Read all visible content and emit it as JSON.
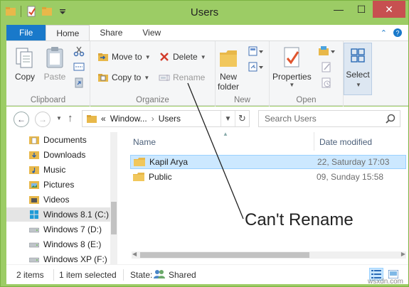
{
  "window": {
    "title": "Users",
    "controls": {
      "minimize": "—",
      "maximize": "☐",
      "close": "✕"
    }
  },
  "ribbon_tabs": [
    {
      "label": "File"
    },
    {
      "label": "Home"
    },
    {
      "label": "Share"
    },
    {
      "label": "View"
    }
  ],
  "ribbon": {
    "clipboard": {
      "label": "Clipboard",
      "copy": "Copy",
      "paste": "Paste"
    },
    "organize": {
      "label": "Organize",
      "move_to": "Move to",
      "copy_to": "Copy to",
      "delete": "Delete",
      "rename": "Rename"
    },
    "new": {
      "label": "New",
      "new_folder_line1": "New",
      "new_folder_line2": "folder"
    },
    "open": {
      "label": "Open",
      "properties": "Properties"
    },
    "select": {
      "label": "Select"
    }
  },
  "address": {
    "chevrons": "«",
    "crumb1": "Window...",
    "crumb_sep": "›",
    "crumb2": "Users"
  },
  "search": {
    "placeholder": "Search Users"
  },
  "nav_items": [
    {
      "label": "Documents",
      "icon": "documents-folder-icon"
    },
    {
      "label": "Downloads",
      "icon": "downloads-folder-icon"
    },
    {
      "label": "Music",
      "icon": "music-folder-icon"
    },
    {
      "label": "Pictures",
      "icon": "pictures-folder-icon"
    },
    {
      "label": "Videos",
      "icon": "videos-folder-icon"
    },
    {
      "label": "Windows 8.1 (C:)",
      "icon": "windows-drive-icon"
    },
    {
      "label": "Windows 7 (D:)",
      "icon": "drive-icon"
    },
    {
      "label": "Windows 8 (E:)",
      "icon": "drive-icon"
    },
    {
      "label": "Windows XP (F:)",
      "icon": "drive-icon"
    }
  ],
  "columns": {
    "name": "Name",
    "date_modified": "Date modified"
  },
  "files": [
    {
      "name": "Kapil Arya",
      "date": "22, Saturday 17:03",
      "selected": true
    },
    {
      "name": "Public",
      "date": "09, Sunday 15:58",
      "selected": false
    }
  ],
  "status": {
    "items_count": "2 items",
    "selected_count": "1 item selected",
    "state_label": "State:",
    "state_value": "Shared"
  },
  "annotation": {
    "text": "Can't Rename"
  },
  "watermark": "wsxdn.com",
  "colors": {
    "titlebar": "#9ccc65",
    "file_tab": "#1979ca",
    "selection": "#cce8ff",
    "close_button": "#c75050"
  }
}
